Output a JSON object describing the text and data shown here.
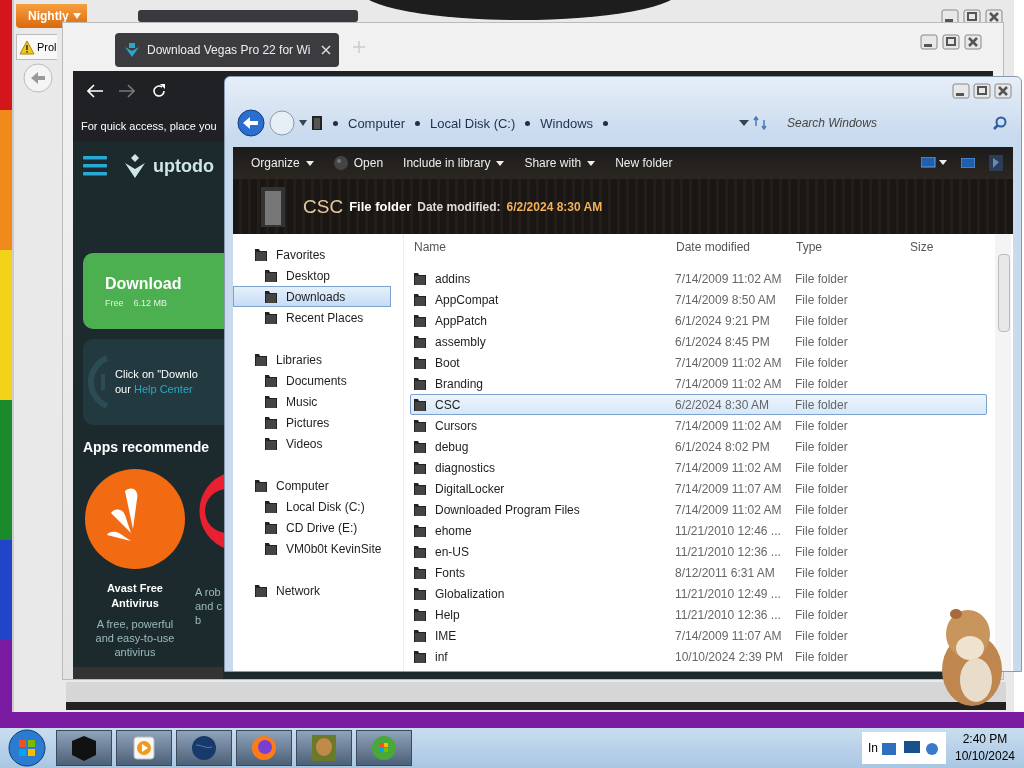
{
  "back_browser": {
    "menu_button": "Nightly",
    "tab": "Prol"
  },
  "browser": {
    "tab": "Download Vegas Pro 22 for Wi",
    "bookmarks_hint": "For quick access, place you",
    "logo": "uptodo",
    "download": {
      "label": "Download",
      "license": "Free",
      "size": "6.12 MB"
    },
    "help": {
      "line_1": "Click on \"Downlo",
      "line_2": "our",
      "link": "Help Center"
    },
    "section_title": "Apps recommende",
    "apps": [
      {
        "name": [
          "Avast Free",
          "Antivirus"
        ],
        "description": [
          "A free, powerful",
          "and easy-to-use",
          "antivirus"
        ]
      },
      {
        "description": [
          "A rob",
          "and c",
          "b"
        ]
      }
    ]
  },
  "explorer": {
    "breadcrumb": [
      "Computer",
      "Local Disk (C:)",
      "Windows"
    ],
    "search_placeholder": "Search Windows",
    "toolbar": [
      {
        "label": "Organize",
        "dropdown": true,
        "kind": "menu"
      },
      {
        "label": "Open",
        "dropdown": false,
        "kind": "action"
      },
      {
        "label": "Include in library",
        "dropdown": true,
        "kind": "menu"
      },
      {
        "label": "Share with",
        "dropdown": true,
        "kind": "menu"
      },
      {
        "label": "New folder",
        "dropdown": false,
        "kind": "menu"
      }
    ],
    "details": {
      "name": "CSC",
      "type": "File folder",
      "date_label": "Date modified:",
      "date": "6/2/2024 8:30 AM"
    },
    "nav": [
      {
        "label": "Favorites",
        "children": [
          {
            "label": "Desktop",
            "selected": false
          },
          {
            "label": "Downloads",
            "selected": true
          },
          {
            "label": "Recent Places",
            "selected": false
          }
        ]
      },
      {
        "label": "Libraries",
        "children": [
          {
            "label": "Documents",
            "selected": false
          },
          {
            "label": "Music",
            "selected": false
          },
          {
            "label": "Pictures",
            "selected": false
          },
          {
            "label": "Videos",
            "selected": false
          }
        ]
      },
      {
        "label": "Computer",
        "children": [
          {
            "label": "Local Disk (C:)",
            "selected": false
          },
          {
            "label": "CD Drive (E:)",
            "selected": false
          },
          {
            "label": "VM0b0t KevinSite",
            "selected": false
          }
        ]
      },
      {
        "label": "Network"
      }
    ],
    "columns": [
      "Name",
      "Date modified",
      "Type",
      "Size"
    ],
    "rows": [
      {
        "name": "addins",
        "date": "7/14/2009 11:02 AM",
        "type": "File folder",
        "selected": false
      },
      {
        "name": "AppCompat",
        "date": "7/14/2009 8:50 AM",
        "type": "File folder",
        "selected": false
      },
      {
        "name": "AppPatch",
        "date": "6/1/2024 9:21 PM",
        "type": "File folder",
        "selected": false
      },
      {
        "name": "assembly",
        "date": "6/1/2024 8:45 PM",
        "type": "File folder",
        "selected": false
      },
      {
        "name": "Boot",
        "date": "7/14/2009 11:02 AM",
        "type": "File folder",
        "selected": false
      },
      {
        "name": "Branding",
        "date": "7/14/2009 11:02 AM",
        "type": "File folder",
        "selected": false
      },
      {
        "name": "CSC",
        "date": "6/2/2024 8:30 AM",
        "type": "File folder",
        "selected": true
      },
      {
        "name": "Cursors",
        "date": "7/14/2009 11:02 AM",
        "type": "File folder",
        "selected": false
      },
      {
        "name": "debug",
        "date": "6/1/2024 8:02 PM",
        "type": "File folder",
        "selected": false
      },
      {
        "name": "diagnostics",
        "date": "7/14/2009 11:02 AM",
        "type": "File folder",
        "selected": false
      },
      {
        "name": "DigitalLocker",
        "date": "7/14/2009 11:07 AM",
        "type": "File folder",
        "selected": false
      },
      {
        "name": "Downloaded Program Files",
        "date": "7/14/2009 11:02 AM",
        "type": "File folder",
        "selected": false
      },
      {
        "name": "ehome",
        "date": "11/21/2010 12:46 ...",
        "type": "File folder",
        "selected": false
      },
      {
        "name": "en-US",
        "date": "11/21/2010 12:36 ...",
        "type": "File folder",
        "selected": false
      },
      {
        "name": "Fonts",
        "date": "8/12/2011 6:31 AM",
        "type": "File folder",
        "selected": false
      },
      {
        "name": "Globalization",
        "date": "11/21/2010 12:49 ...",
        "type": "File folder",
        "selected": false
      },
      {
        "name": "Help",
        "date": "11/21/2010 12:36 ...",
        "type": "File folder",
        "selected": false
      },
      {
        "name": "IME",
        "date": "7/14/2009 11:07 AM",
        "type": "File folder",
        "selected": false
      },
      {
        "name": "inf",
        "date": "10/10/2024 2:39 PM",
        "type": "File folder",
        "selected": false
      }
    ]
  },
  "taskbar": {
    "tray_label": "In",
    "time": "2:40 PM",
    "date": "10/10/2024"
  }
}
